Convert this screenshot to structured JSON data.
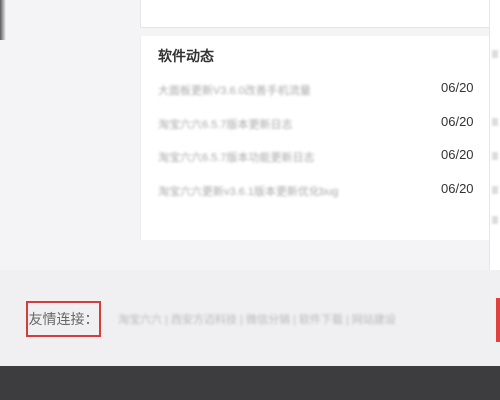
{
  "news": {
    "title": "软件动态",
    "items": [
      {
        "text": "大面板更新V3.6.0改善手机流量",
        "date": "06/20"
      },
      {
        "text": "淘宝六六6.5.7版本更新日志",
        "date": "06/20"
      },
      {
        "text": "淘宝六六6.5.7版本功能更新日志",
        "date": "06/20"
      },
      {
        "text": "淘宝六六更新v3.6.1版本更新优化bug",
        "date": "06/20"
      }
    ]
  },
  "footer": {
    "links_label": "友情连接：",
    "links_text": "淘宝六六 | 西安方迈科技 | 微信分销 | 软件下载 | 网站建设"
  }
}
